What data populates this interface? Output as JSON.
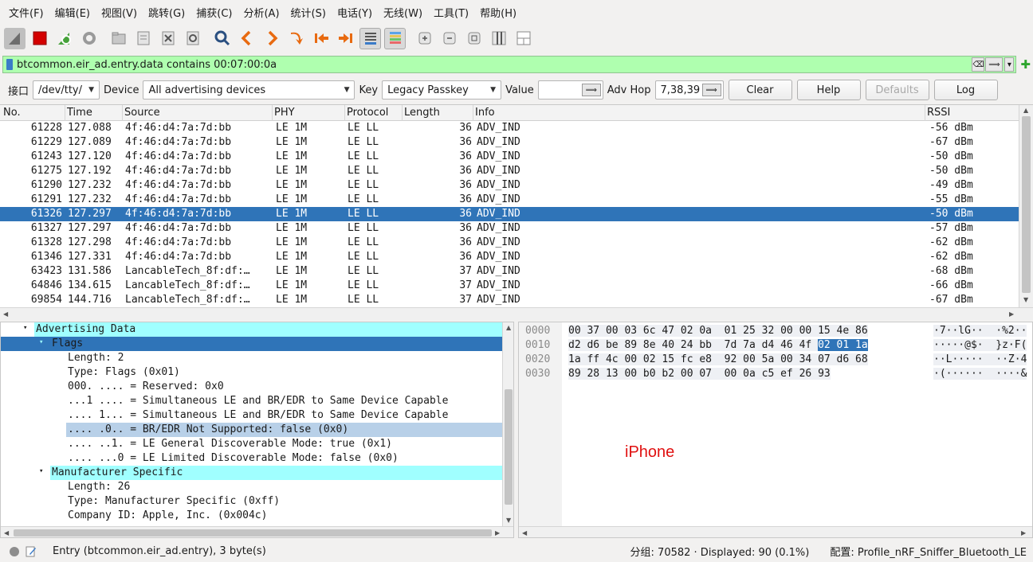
{
  "menu": [
    "文件(F)",
    "编辑(E)",
    "视图(V)",
    "跳转(G)",
    "捕获(C)",
    "分析(A)",
    "统计(S)",
    "电话(Y)",
    "无线(W)",
    "工具(T)",
    "帮助(H)"
  ],
  "filter": {
    "value": "btcommon.eir_ad.entry.data contains 00:07:00:0a",
    "clear_glyph": "⌫",
    "apply_glyph": "⟹",
    "dropdown_glyph": "▾",
    "add_glyph": "✚",
    "valid_color": "#afffaf"
  },
  "sniffer": {
    "interface_label": "接口",
    "interface_value": "/dev/tty/",
    "device_label": "Device",
    "device_value": "All advertising devices",
    "key_label": "Key",
    "key_value": "Legacy Passkey",
    "value_label": "Value",
    "value_value": "",
    "value_arrow": "⟹",
    "advhop_label": "Adv Hop",
    "advhop_value": "7,38,39",
    "advhop_arrow": "⟹",
    "buttons": {
      "clear": "Clear",
      "help": "Help",
      "defaults": "Defaults",
      "log": "Log"
    }
  },
  "packet_list": {
    "columns": [
      "No.",
      "Time",
      "Source",
      "PHY",
      "Protocol",
      "Length",
      "Info",
      "RSSI"
    ],
    "selected_index": 6,
    "rows": [
      {
        "no": "61228",
        "time": "127.088",
        "source": "4f:46:d4:7a:7d:bb",
        "phy": "LE 1M",
        "protocol": "LE LL",
        "length": "36",
        "info": "ADV_IND",
        "rssi": "-56 dBm"
      },
      {
        "no": "61229",
        "time": "127.089",
        "source": "4f:46:d4:7a:7d:bb",
        "phy": "LE 1M",
        "protocol": "LE LL",
        "length": "36",
        "info": "ADV_IND",
        "rssi": "-67 dBm"
      },
      {
        "no": "61243",
        "time": "127.120",
        "source": "4f:46:d4:7a:7d:bb",
        "phy": "LE 1M",
        "protocol": "LE LL",
        "length": "36",
        "info": "ADV_IND",
        "rssi": "-50 dBm"
      },
      {
        "no": "61275",
        "time": "127.192",
        "source": "4f:46:d4:7a:7d:bb",
        "phy": "LE 1M",
        "protocol": "LE LL",
        "length": "36",
        "info": "ADV_IND",
        "rssi": "-50 dBm"
      },
      {
        "no": "61290",
        "time": "127.232",
        "source": "4f:46:d4:7a:7d:bb",
        "phy": "LE 1M",
        "protocol": "LE LL",
        "length": "36",
        "info": "ADV_IND",
        "rssi": "-49 dBm"
      },
      {
        "no": "61291",
        "time": "127.232",
        "source": "4f:46:d4:7a:7d:bb",
        "phy": "LE 1M",
        "protocol": "LE LL",
        "length": "36",
        "info": "ADV_IND",
        "rssi": "-55 dBm"
      },
      {
        "no": "61326",
        "time": "127.297",
        "source": "4f:46:d4:7a:7d:bb",
        "phy": "LE 1M",
        "protocol": "LE LL",
        "length": "36",
        "info": "ADV_IND",
        "rssi": "-50 dBm"
      },
      {
        "no": "61327",
        "time": "127.297",
        "source": "4f:46:d4:7a:7d:bb",
        "phy": "LE 1M",
        "protocol": "LE LL",
        "length": "36",
        "info": "ADV_IND",
        "rssi": "-57 dBm"
      },
      {
        "no": "61328",
        "time": "127.298",
        "source": "4f:46:d4:7a:7d:bb",
        "phy": "LE 1M",
        "protocol": "LE LL",
        "length": "36",
        "info": "ADV_IND",
        "rssi": "-62 dBm"
      },
      {
        "no": "61346",
        "time": "127.331",
        "source": "4f:46:d4:7a:7d:bb",
        "phy": "LE 1M",
        "protocol": "LE LL",
        "length": "36",
        "info": "ADV_IND",
        "rssi": "-62 dBm"
      },
      {
        "no": "63423",
        "time": "131.586",
        "source": "LancableTech_8f:df:…",
        "phy": "LE 1M",
        "protocol": "LE LL",
        "length": "37",
        "info": "ADV_IND",
        "rssi": "-68 dBm"
      },
      {
        "no": "64846",
        "time": "134.615",
        "source": "LancableTech_8f:df:…",
        "phy": "LE 1M",
        "protocol": "LE LL",
        "length": "37",
        "info": "ADV_IND",
        "rssi": "-66 dBm"
      },
      {
        "no": "69854",
        "time": "144.716",
        "source": "LancableTech_8f:df:…",
        "phy": "LE 1M",
        "protocol": "LE LL",
        "length": "37",
        "info": "ADV_IND",
        "rssi": "-67 dBm"
      }
    ]
  },
  "detail_tree": [
    {
      "text": "Advertising Data",
      "toggle": "▾",
      "style": "cyan"
    },
    {
      "text": "Flags",
      "toggle": "▾",
      "style": "selected"
    },
    {
      "text": "Length: 2",
      "toggle": "",
      "style": ""
    },
    {
      "text": "Type: Flags (0x01)",
      "toggle": "",
      "style": ""
    },
    {
      "text": "000. .... = Reserved: 0x0",
      "toggle": "",
      "style": ""
    },
    {
      "text": "...1 .... = Simultaneous LE and BR/EDR to Same Device Capable",
      "toggle": "",
      "style": ""
    },
    {
      "text": ".... 1... = Simultaneous LE and BR/EDR to Same Device Capable",
      "toggle": "",
      "style": ""
    },
    {
      "text": ".... .0.. = BR/EDR Not Supported: false (0x0)",
      "toggle": "",
      "style": "grey"
    },
    {
      "text": ".... ..1. = LE General Discoverable Mode: true (0x1)",
      "toggle": "",
      "style": ""
    },
    {
      "text": ".... ...0 = LE Limited Discoverable Mode: false (0x0)",
      "toggle": "",
      "style": ""
    },
    {
      "text": "Manufacturer Specific",
      "toggle": "▾",
      "style": "cyan"
    },
    {
      "text": "Length: 26",
      "toggle": "",
      "style": ""
    },
    {
      "text": "Type: Manufacturer Specific (0xff)",
      "toggle": "",
      "style": ""
    },
    {
      "text": "Company ID: Apple, Inc. (0x004c)",
      "toggle": "",
      "style": ""
    }
  ],
  "bytes": [
    {
      "offset": "0000",
      "hex_pre": "00 37 00 03 6c 47 02 0a  01 25 32 00 00 15 4e 86",
      "hex_sel": "",
      "ascii": "·7··lG··  ·%2··"
    },
    {
      "offset": "0010",
      "hex_pre": "d2 d6 be 89 8e 40 24 bb  7d 7a d4 46 4f ",
      "hex_sel": "02 01 1a",
      "ascii": "·····@$·  }z·F("
    },
    {
      "offset": "0020",
      "hex_pre": "1a ff 4c 00 02 15 fc e8  92 00 5a 00 34 07 d6 68",
      "hex_sel": "",
      "ascii": "··L·····  ··Z·4"
    },
    {
      "offset": "0030",
      "hex_pre": "89 28 13 00 b0 b2 00 07  00 0a c5 ef 26 93",
      "hex_sel": "",
      "ascii": "·(······  ····&"
    }
  ],
  "annotation": "iPhone",
  "status": {
    "left": "Entry (btcommon.eir_ad.entry), 3 byte(s)",
    "middle": "分组: 70582 · Displayed: 90 (0.1%)",
    "right": "配置: Profile_nRF_Sniffer_Bluetooth_LE"
  },
  "colors": {
    "selection": "#2f74b8",
    "tree_highlight": "#a0ffff",
    "annotation": "#e01010"
  }
}
